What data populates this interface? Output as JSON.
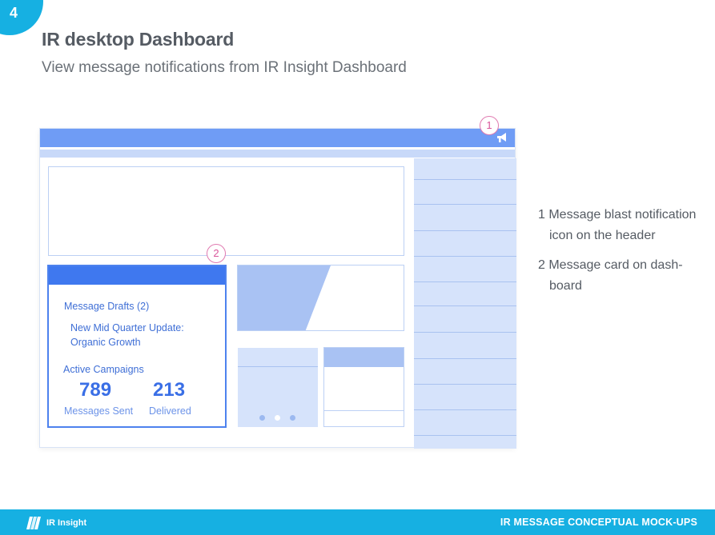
{
  "slide": {
    "number": "4",
    "title": "IR desktop Dashboard",
    "subtitle": "View message notifications from IR Insight Dashboard"
  },
  "mockup": {
    "annotation_1": "1",
    "annotation_2": "2",
    "header_icon": "megaphone-icon",
    "message_card": {
      "drafts_label": "Message Drafts (2)",
      "draft_title_line1": "New Mid Quarter Update:",
      "draft_title_line2": "Organic Growth",
      "active_campaigns_label": "Active Campaigns",
      "messages_sent_value": "789",
      "messages_sent_label": "Messages Sent",
      "delivered_value": "213",
      "delivered_label": "Delivered"
    }
  },
  "notes": [
    {
      "line1": "1 Message blast notification",
      "line2": "icon on the header"
    },
    {
      "line1": "2 Message card on dash-",
      "line2": "board"
    }
  ],
  "footer": {
    "brand": "IR Insight",
    "logo_icon": "ir-insight-logo-icon",
    "right_text": "IR MESSAGE CONCEPTUAL MOCK-UPS"
  },
  "colors": {
    "accent": "#16b0e2",
    "mock_header": "#6f9cf5",
    "card_blue": "#3f78ef",
    "light_panel": "#d6e3fb",
    "annotation": "#e07ab0"
  }
}
